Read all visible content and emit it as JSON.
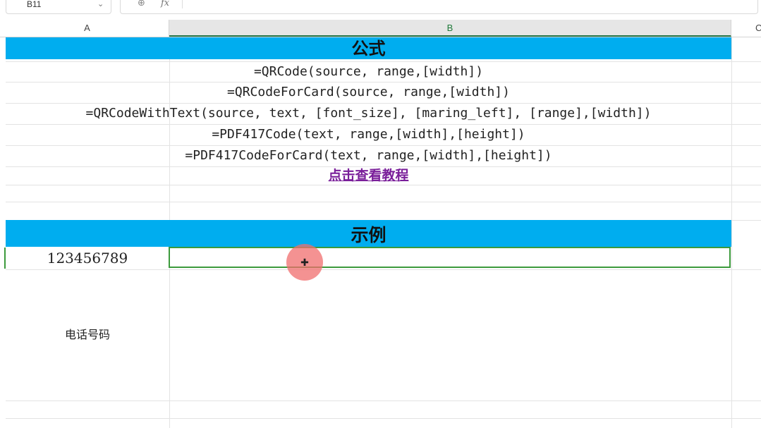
{
  "formula_bar": {
    "cell_ref": "B11",
    "zoom_icon": "magnifier-icon",
    "fx_label": "fx"
  },
  "columns": [
    "A",
    "B",
    "C"
  ],
  "sheet": {
    "section1_title": "公式",
    "formulas": [
      "=QRCode(source, range,[width])",
      "=QRCodeForCard(source, range,[width])",
      "=QRCodeWithText(source, text, [font_size], [maring_left], [range],[width])",
      "=PDF417Code(text, range,[width],[height])",
      "=PDF417CodeForCard(text, range,[width],[height])"
    ],
    "tutorial_link": "点击查看教程",
    "section2_title": "示例",
    "example_value": "123456789",
    "phone_label": "电话号码"
  },
  "colors": {
    "banner": "#00adef",
    "selection": "#3c9a3c",
    "link": "#7a1f9a"
  }
}
